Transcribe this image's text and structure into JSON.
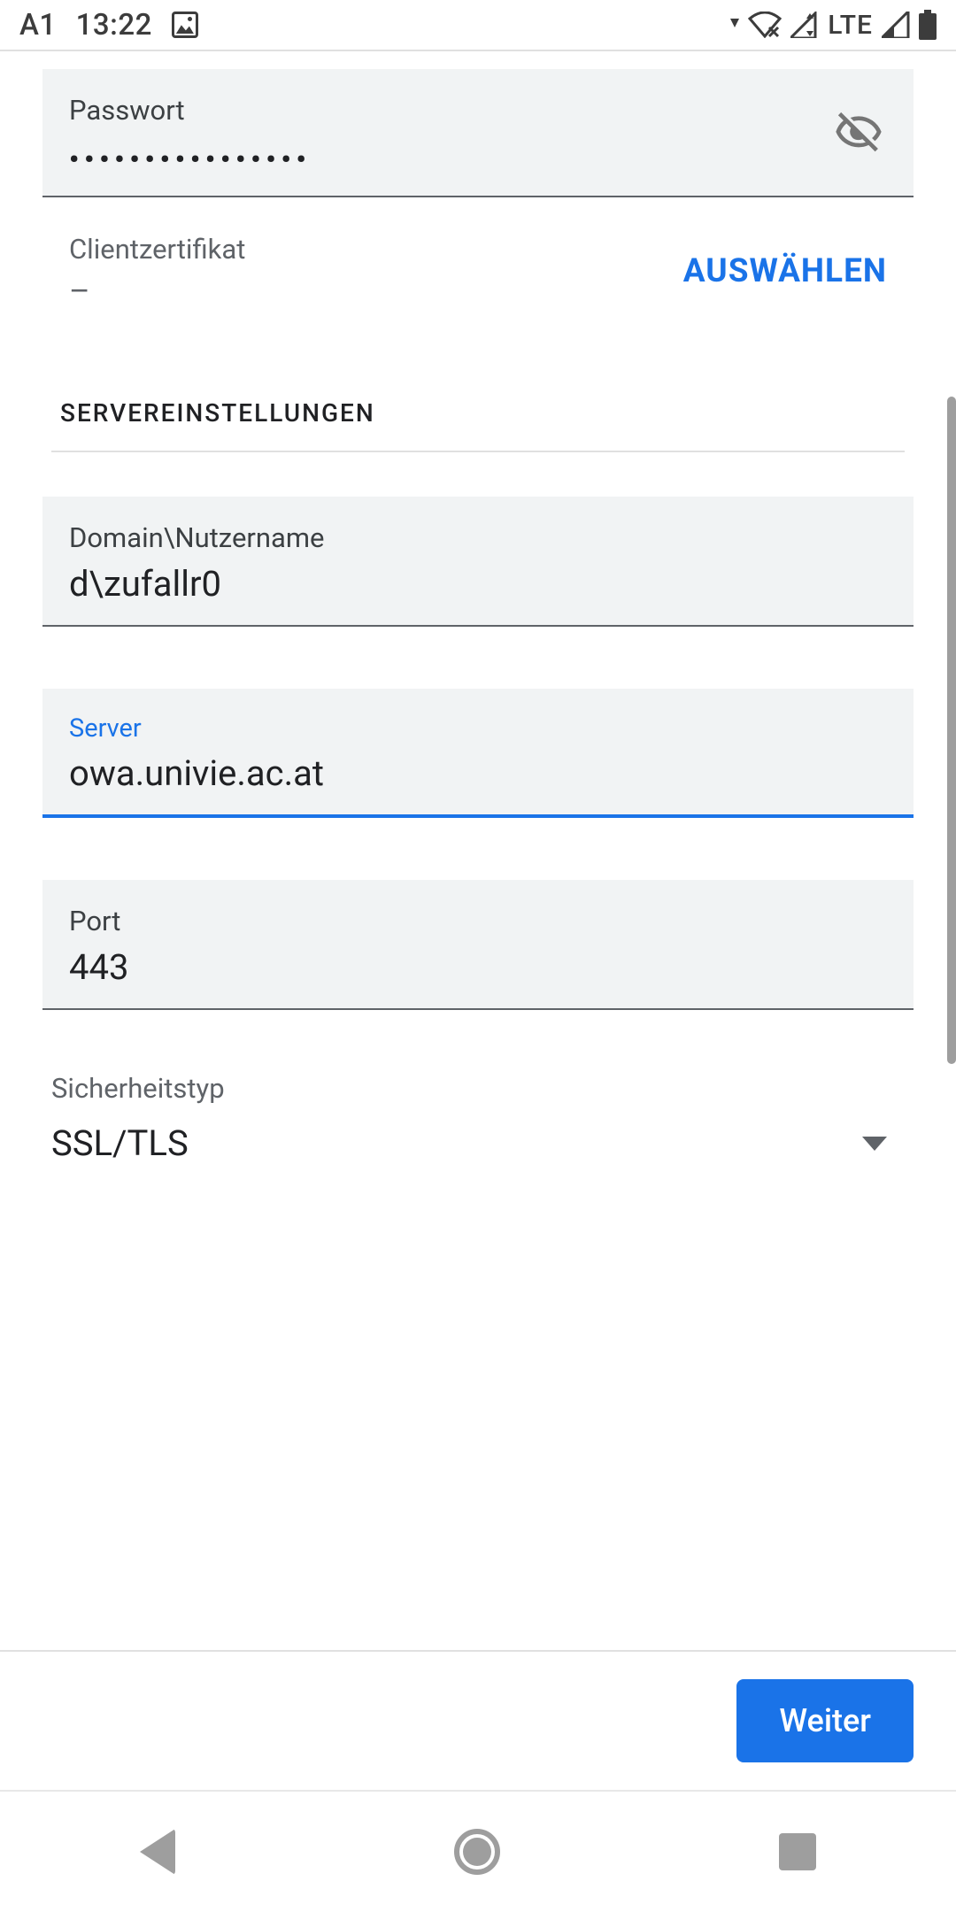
{
  "status": {
    "carrier": "A1",
    "time": "13:22",
    "network_label": "LTE"
  },
  "password": {
    "label": "Passwort",
    "value_masked": "••••••••••••••••"
  },
  "client_cert": {
    "label": "Clientzertifikat",
    "value": "–",
    "select_button": "AUSWÄHLEN"
  },
  "sections": {
    "server": "SERVEREINSTELLUNGEN"
  },
  "domain_user": {
    "label": "Domain\\Nutzername",
    "value": "d\\zufallr0"
  },
  "server": {
    "label": "Server",
    "value": "owa.univie.ac.at"
  },
  "port": {
    "label": "Port",
    "value": "443"
  },
  "security": {
    "label": "Sicherheitstyp",
    "value": "SSL/TLS"
  },
  "actions": {
    "next": "Weiter"
  }
}
